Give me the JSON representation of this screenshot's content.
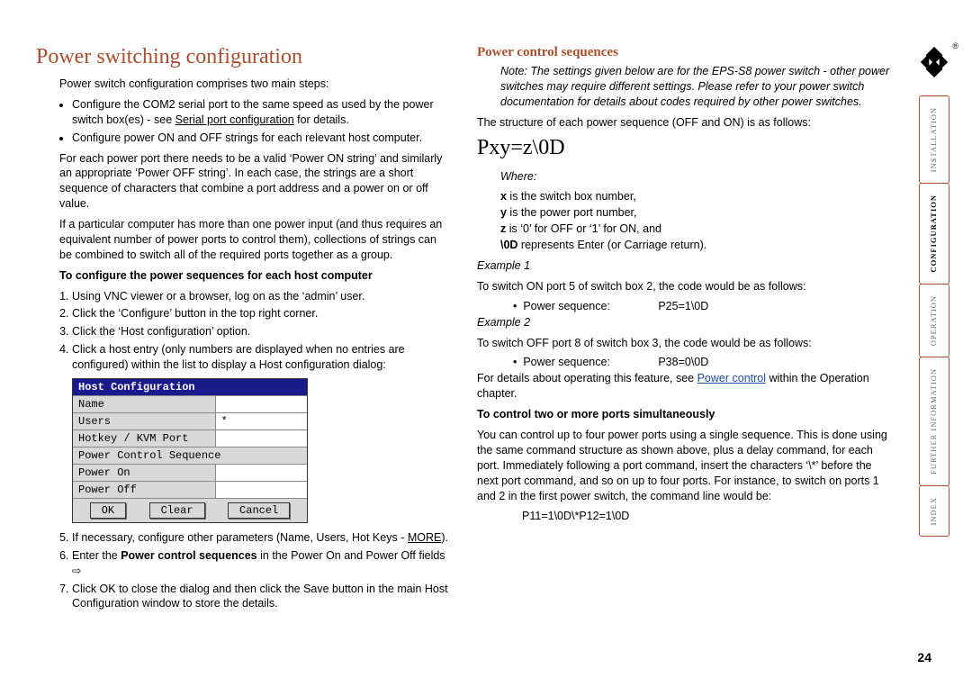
{
  "left": {
    "title": "Power switching configuration",
    "intro": "Power switch configuration comprises two main steps:",
    "bullets": [
      "Configure the COM2 serial port to the same speed as used by the power switch box(es) - see ",
      "Configure power ON and OFF strings for each relevant host computer."
    ],
    "link_serial": "Serial port configuration",
    "link_serial_after": " for details.",
    "para1": "For each power port there needs to be a valid ‘Power ON string’ and similarly an appropriate ‘Power OFF string’. In each case, the strings are a short sequence of characters that combine a port address and a power on or off value.",
    "para2": "If a particular computer has more than one power input (and thus requires an equivalent number of power ports to control them), collections of strings can be combined to switch all of the required ports together as a group.",
    "sub1": "To configure the power sequences for each host computer",
    "steps": [
      "Using VNC viewer or a browser, log on as the ‘admin’ user.",
      "Click the ‘Configure’ button in the top right corner.",
      "Click the ‘Host configuration’ option.",
      "Click a host entry (only numbers are displayed when no entries are configured) within the list to display a Host configuration dialog:"
    ],
    "dialog": {
      "title": "Host Configuration",
      "rows": [
        {
          "label": "Name",
          "value": ""
        },
        {
          "label": "Users",
          "value": "*"
        },
        {
          "label": "Hotkey / KVM Port",
          "value": ""
        },
        {
          "label": "Power Control Sequence",
          "value": ""
        },
        {
          "label": "Power On",
          "value": ""
        },
        {
          "label": "Power Off",
          "value": ""
        }
      ],
      "buttons": [
        "OK",
        "Clear",
        "Cancel"
      ]
    },
    "step5a": "If necessary, configure other parameters (Name, Users, Hot Keys - ",
    "link_more": "MORE",
    "step5b": ").",
    "step6a": "Enter the ",
    "step6b": "Power control sequences",
    "step6c": " in the Power On and Power Off fields ",
    "step7": "Click OK to close the dialog and then click the Save button in the main Host Configuration window to store the details."
  },
  "right": {
    "title": "Power control sequences",
    "note": "Note: The settings given below are for the EPS-S8 power switch - other power switches may require different settings. Please refer to your power switch documentation for details about codes required by other power switches.",
    "intro": "The structure of each power sequence (OFF and ON) is as follows:",
    "formula": "Pxy=z\\0D",
    "where": "Where:",
    "wlines": [
      [
        "x",
        " is the switch box number,"
      ],
      [
        "y",
        " is the power port number,"
      ],
      [
        "z",
        " is ‘0’ for OFF or ‘1’ for ON, and"
      ],
      [
        "\\0D",
        " represents Enter (or Carriage return)."
      ]
    ],
    "ex1": "Example 1",
    "ex1_text": "To switch ON port 5 of switch box 2, the code would be as follows:",
    "ex1_label": "Power sequence:",
    "ex1_val": "P25=1\\0D",
    "ex2": "Example 2",
    "ex2_text": "To switch OFF port 8 of switch box 3, the code would be as follows:",
    "ex2_label": "Power sequence:",
    "ex2_val": "P38=0\\0D",
    "details_a": "For details about operating this feature, see ",
    "details_link": "Power control",
    "details_b": " within the Operation chapter.",
    "sub2": "To control two or more ports simultaneously",
    "multi": "You can control up to four power ports using a single sequence. This is done using the same command structure as shown above, plus a delay command, for each port. Immediately following a port command, insert the characters ‘\\*’ before the next port command, and so on up to four ports. For instance, to switch on ports 1 and 2 in the first power switch, the command line would be:",
    "cmd": "P11=1\\0D\\*P12=1\\0D"
  },
  "nav": [
    "INSTALLATION",
    "CONFIGURATION",
    "OPERATION",
    "FURTHER INFORMATION",
    "INDEX"
  ],
  "pagenum": "24"
}
